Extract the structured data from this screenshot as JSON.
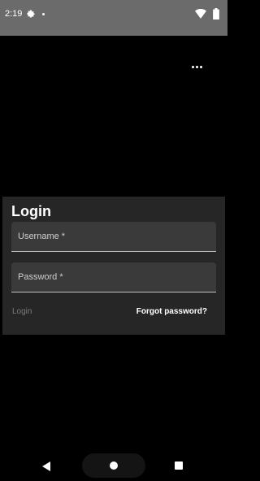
{
  "status_bar": {
    "time": "2:19",
    "icons": [
      "gear-icon",
      "dot-icon",
      "wifi-icon",
      "battery-icon"
    ]
  },
  "toolbar": {
    "overflow_icon": "more-horizontal-icon"
  },
  "login_card": {
    "title": "Login",
    "username_label": "Username *",
    "password_label": "Password *",
    "login_button": "Login",
    "forgot_password": "Forgot password?"
  },
  "nav_bar": {
    "icons": [
      "back-icon",
      "home-icon",
      "recents-icon"
    ]
  },
  "colors": {
    "background": "#000000",
    "status_bar": "#6b6b6b",
    "card": "#262626",
    "field": "#3a3a3a"
  }
}
